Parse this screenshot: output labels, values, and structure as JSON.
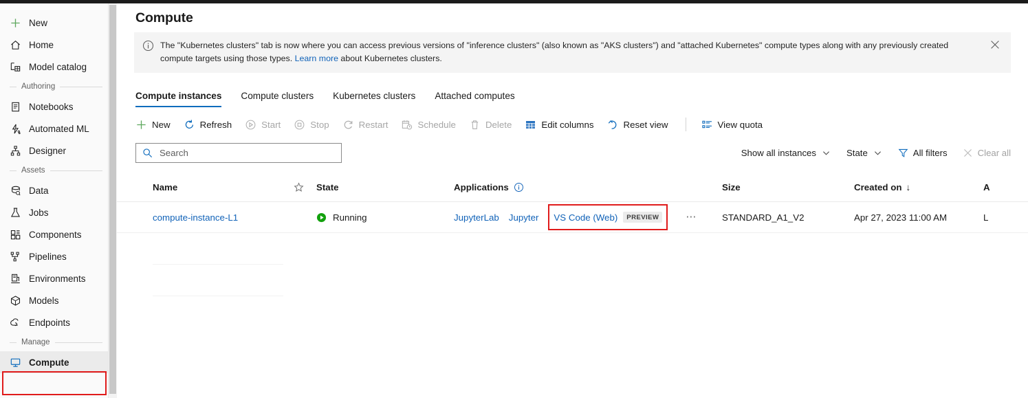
{
  "sidebar": {
    "items": [
      {
        "label": "New",
        "icon": "plus-icon",
        "type": "item",
        "state": "normal"
      },
      {
        "label": "Home",
        "icon": "home-icon",
        "type": "item",
        "state": "normal"
      },
      {
        "label": "Model catalog",
        "icon": "model-catalog-icon",
        "type": "item",
        "state": "normal"
      },
      {
        "label": "Authoring",
        "icon": "",
        "type": "group",
        "state": "normal"
      },
      {
        "label": "Notebooks",
        "icon": "notebook-icon",
        "type": "item",
        "state": "normal"
      },
      {
        "label": "Automated ML",
        "icon": "automated-ml-icon",
        "type": "item",
        "state": "normal"
      },
      {
        "label": "Designer",
        "icon": "designer-icon",
        "type": "item",
        "state": "normal"
      },
      {
        "label": "Assets",
        "icon": "",
        "type": "group",
        "state": "normal"
      },
      {
        "label": "Data",
        "icon": "data-icon",
        "type": "item",
        "state": "normal"
      },
      {
        "label": "Jobs",
        "icon": "jobs-icon",
        "type": "item",
        "state": "normal"
      },
      {
        "label": "Components",
        "icon": "components-icon",
        "type": "item",
        "state": "normal"
      },
      {
        "label": "Pipelines",
        "icon": "pipelines-icon",
        "type": "item",
        "state": "normal"
      },
      {
        "label": "Environments",
        "icon": "environments-icon",
        "type": "item",
        "state": "normal"
      },
      {
        "label": "Models",
        "icon": "models-icon",
        "type": "item",
        "state": "normal"
      },
      {
        "label": "Endpoints",
        "icon": "endpoints-icon",
        "type": "item",
        "state": "normal"
      },
      {
        "label": "Manage",
        "icon": "",
        "type": "group",
        "state": "normal"
      },
      {
        "label": "Compute",
        "icon": "compute-icon",
        "type": "item",
        "state": "selected"
      }
    ]
  },
  "header": {
    "title": "Compute"
  },
  "banner": {
    "icon": "info-icon",
    "text_before_link": "The \"Kubernetes clusters\" tab is now where you can access previous versions of \"inference clusters\" (also known as \"AKS clusters\") and \"attached Kubernetes\" compute types along with any previously created compute targets using those types. ",
    "link_label": "Learn more",
    "text_after_link": " about Kubernetes clusters.",
    "close_icon": "close-icon"
  },
  "tabs": [
    {
      "label": "Compute instances",
      "active": true
    },
    {
      "label": "Compute clusters",
      "active": false
    },
    {
      "label": "Kubernetes clusters",
      "active": false
    },
    {
      "label": "Attached computes",
      "active": false
    }
  ],
  "toolbar": {
    "commands": [
      {
        "label": "New",
        "icon": "plus-icon",
        "disabled": false
      },
      {
        "label": "Refresh",
        "icon": "refresh-icon",
        "disabled": false
      },
      {
        "label": "Start",
        "icon": "play-icon",
        "disabled": true
      },
      {
        "label": "Stop",
        "icon": "stop-icon",
        "disabled": true
      },
      {
        "label": "Restart",
        "icon": "restart-icon",
        "disabled": true
      },
      {
        "label": "Schedule",
        "icon": "schedule-icon",
        "disabled": true
      },
      {
        "label": "Delete",
        "icon": "trash-icon",
        "disabled": true
      },
      {
        "label": "Edit columns",
        "icon": "columns-icon",
        "disabled": false
      },
      {
        "label": "Reset view",
        "icon": "reset-view-icon",
        "disabled": false
      }
    ],
    "quota": {
      "label": "View quota",
      "icon": "quota-icon"
    }
  },
  "search": {
    "placeholder": "Search",
    "value": "",
    "icon": "search-icon"
  },
  "filters": [
    {
      "label": "Show all instances",
      "icon": "chevron-down-icon",
      "muted": false
    },
    {
      "label": "State",
      "icon": "chevron-down-icon",
      "muted": false
    },
    {
      "label": "All filters",
      "icon": "funnel-icon",
      "muted": false
    },
    {
      "label": "Clear all",
      "icon": "close-icon",
      "muted": true
    }
  ],
  "table": {
    "columns": {
      "name": "Name",
      "star": "star-icon",
      "state": "State",
      "applications": "Applications",
      "applications_info_icon": "info-icon",
      "size": "Size",
      "created_on": "Created on",
      "created_on_sort": "↓",
      "last_col_partial": "A"
    },
    "rows": [
      {
        "name": "compute-instance-L1",
        "state": "Running",
        "state_icon": "running-play-icon",
        "apps": [
          {
            "label": "JupyterLab",
            "highlighted": false,
            "badge": ""
          },
          {
            "label": "Jupyter",
            "highlighted": false,
            "badge": ""
          },
          {
            "label": "VS Code (Web)",
            "highlighted": true,
            "badge": "PREVIEW"
          }
        ],
        "overflow_menu": "⋯",
        "size": "STANDARD_A1_V2",
        "created_on": "Apr 27, 2023 11:00 AM",
        "last_col_partial": "L"
      }
    ]
  },
  "colors": {
    "accent": "#0f6cbd",
    "link": "#1062b8",
    "highlight_box": "#e01b1b",
    "running_green": "#13a10e",
    "banner_bg": "#f4f4f4",
    "sidebar_bg": "#fafafa",
    "selected_bg": "#ebebeb"
  }
}
